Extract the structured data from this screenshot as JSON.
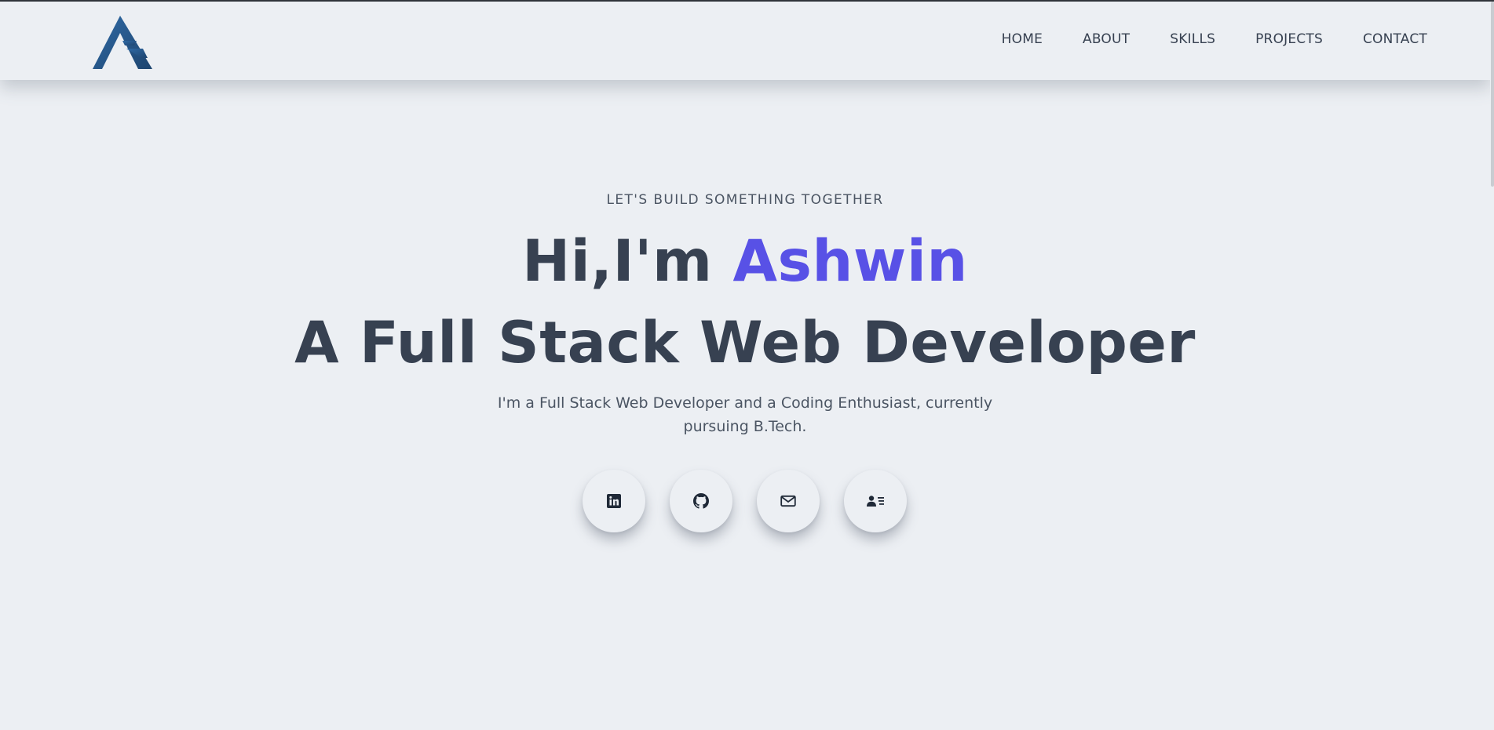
{
  "nav": {
    "items": [
      {
        "label": "HOME"
      },
      {
        "label": "ABOUT"
      },
      {
        "label": "SKILLS"
      },
      {
        "label": "PROJECTS"
      },
      {
        "label": "CONTACT"
      }
    ]
  },
  "hero": {
    "eyebrow": "LET'S BUILD SOMETHING TOGETHER",
    "greeting": "Hi,I'm ",
    "name": "Ashwin",
    "role": "A Full Stack Web Developer",
    "tagline": "I'm a Full Stack Web Developer and a Coding Enthusiast, currently pursuing B.Tech."
  },
  "socials": [
    {
      "icon": "linkedin-icon"
    },
    {
      "icon": "github-icon"
    },
    {
      "icon": "mail-icon"
    },
    {
      "icon": "contact-card-icon"
    }
  ],
  "colors": {
    "background": "#eceff3",
    "text": "#374151",
    "accent": "#5851e6",
    "logo": "#2b5f96"
  }
}
